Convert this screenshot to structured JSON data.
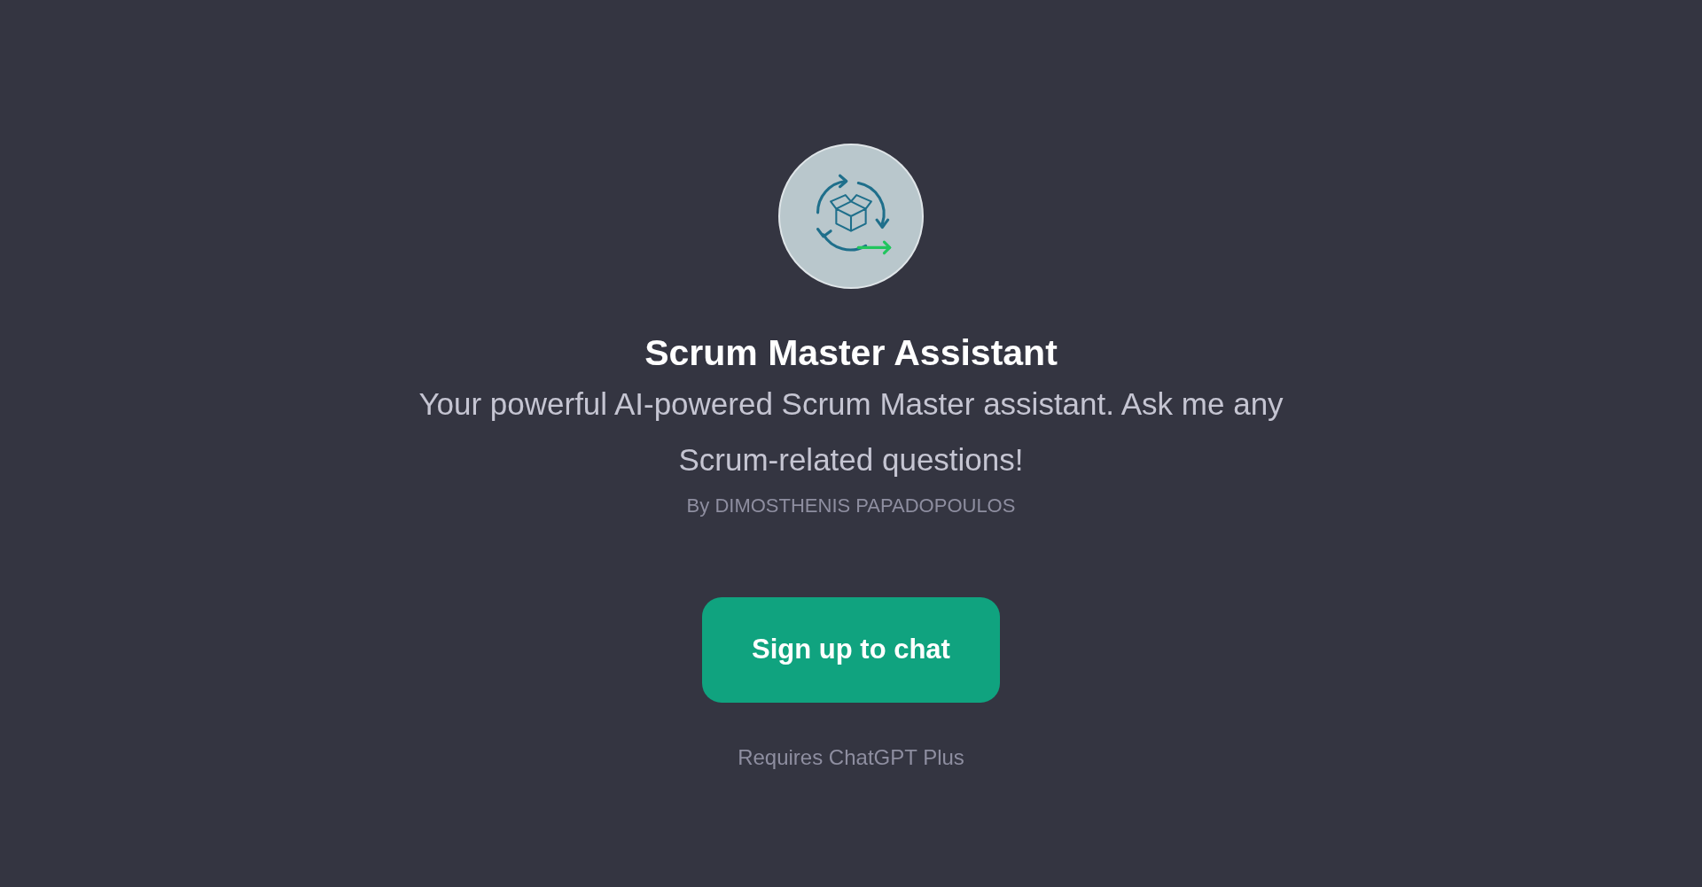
{
  "gpt": {
    "title": "Scrum Master Assistant",
    "description": "Your powerful AI-powered Scrum Master assistant. Ask me any Scrum-related questions!",
    "author": "By DIMOSTHENIS PAPADOPOULOS"
  },
  "button": {
    "label": "Sign up to chat"
  },
  "note": "Requires ChatGPT Plus"
}
